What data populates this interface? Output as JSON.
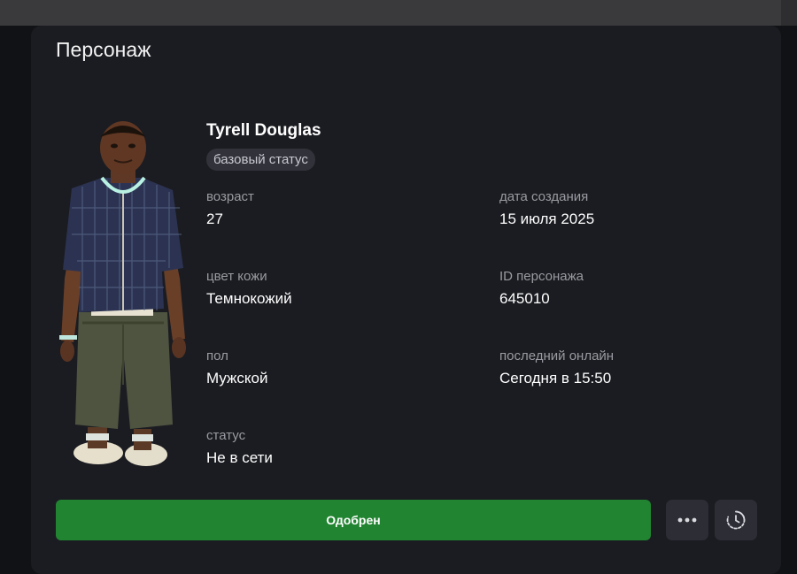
{
  "card": {
    "title": "Персонаж"
  },
  "character": {
    "name": "Tyrell Douglas",
    "status_badge": "базовый статус",
    "fields": [
      {
        "label": "возраст",
        "value": "27"
      },
      {
        "label": "дата создания",
        "value": "15 июля 2025"
      },
      {
        "label": "цвет кожи",
        "value": "Темнокожий"
      },
      {
        "label": "ID персонажа",
        "value": "645010"
      },
      {
        "label": "пол",
        "value": "Мужской"
      },
      {
        "label": "последний онлайн",
        "value": "Сегодня в 15:50"
      },
      {
        "label": "статус",
        "value": "Не в сети"
      }
    ]
  },
  "actions": {
    "approve_label": "Одобрен",
    "more_icon": "more-horizontal-icon",
    "history_icon": "history-clock-icon"
  },
  "colors": {
    "approve": "#218431",
    "card_bg": "#1b1c21",
    "page_bg": "#111215"
  }
}
